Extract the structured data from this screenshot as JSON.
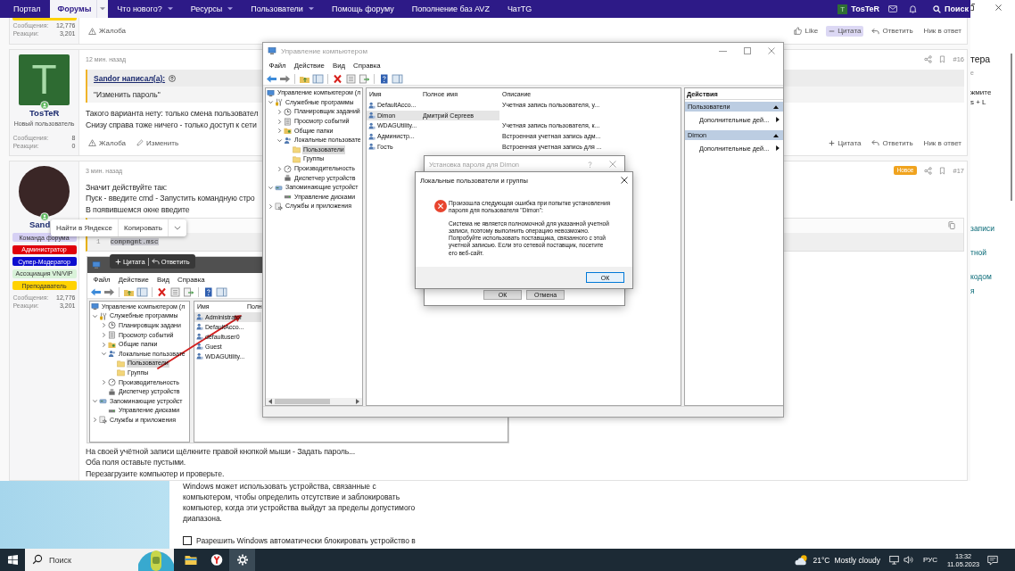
{
  "forum": {
    "nav": {
      "items": [
        {
          "label": "Портал",
          "selected": false,
          "dropdown": false
        },
        {
          "label": "Форумы",
          "selected": true,
          "dropdown": true
        },
        {
          "label": "Что нового?",
          "selected": false,
          "dropdown": true
        },
        {
          "label": "Ресурсы",
          "selected": false,
          "dropdown": true
        },
        {
          "label": "Пользователи",
          "selected": false,
          "dropdown": true
        },
        {
          "label": "Помощь форуму",
          "selected": false,
          "dropdown": false
        },
        {
          "label": "Пополнение баз AVZ",
          "selected": false,
          "dropdown": false
        },
        {
          "label": "ЧатTG",
          "selected": false,
          "dropdown": false
        }
      ],
      "account": {
        "initial": "T",
        "name": "TosTeR"
      },
      "search": "Поиск"
    },
    "posts": [
      {
        "kind": "tail",
        "author": {
          "badges": [
            {
              "color": "#ffd200"
            }
          ]
        },
        "stats": [
          {
            "label": "Сообщения:",
            "value": "12,776"
          },
          {
            "label": "Реакции:",
            "value": "3,201"
          }
        ],
        "actions": [
          {
            "kind": "report",
            "label": "Жалоба"
          }
        ],
        "reactions": [
          {
            "kind": "like",
            "label": "Like",
            "selected": false
          },
          {
            "kind": "quote",
            "label": "Цитата",
            "selected": true
          },
          {
            "kind": "reply",
            "label": "Ответить",
            "selected": false
          },
          {
            "kind": "mention",
            "label": "Ник в ответ",
            "selected": false
          }
        ]
      },
      {
        "kind": "post",
        "time": "12 мин. назад",
        "number": "#16",
        "author": {
          "avatar": {
            "kind": "letter",
            "initial": "T"
          },
          "name": "TosTeR",
          "title": "Новый пользователь",
          "online": true
        },
        "stats": [
          {
            "label": "Сообщения:",
            "value": "8"
          },
          {
            "label": "Реакции:",
            "value": "0"
          }
        ],
        "blocks": [
          {
            "kind": "quote",
            "author": "Sandor написал(а):",
            "text": "\"Изменить пароль\""
          },
          {
            "kind": "text",
            "text": "Такого варианта нету: только смена пользовател"
          },
          {
            "kind": "text",
            "text": "Снизу справа тоже ничего - только доступ к сети"
          }
        ],
        "actions": [
          {
            "kind": "report",
            "label": "Жалоба"
          },
          {
            "kind": "edit",
            "label": "Изменить"
          }
        ],
        "reactions": [
          {
            "kind": "quote",
            "label": "Цитата",
            "selected": false
          },
          {
            "kind": "reply",
            "label": "Ответить",
            "selected": false
          },
          {
            "kind": "mention",
            "label": "Ник в ответ",
            "selected": false
          }
        ]
      },
      {
        "kind": "post",
        "time": "3 мин. назад",
        "new_badge": "Новое",
        "number": "#17",
        "author": {
          "avatar": {
            "kind": "photo"
          },
          "name": "Sand",
          "online": true,
          "badges": [
            {
              "label": "Команда форума",
              "color": "#d6d0f4"
            },
            {
              "label": "Администратор",
              "color": "#e0000b"
            },
            {
              "label": "Супер-Модератор",
              "color": "#0c0ccf"
            },
            {
              "label": "Ассоциация VN/VIP",
              "color": "#d9f2d9"
            },
            {
              "label": "Преподаватель",
              "color": "#ffd200"
            }
          ]
        },
        "stats": [
          {
            "label": "Сообщения:",
            "value": "12,776"
          },
          {
            "label": "Реакции:",
            "value": "3,201"
          }
        ],
        "blocks": [
          {
            "kind": "text",
            "text": "Значит действуйте так:"
          },
          {
            "kind": "text",
            "text": "Пуск - введите cmd - Запустить командную стро"
          },
          {
            "kind": "text",
            "text": "В появившемся окне введите"
          },
          {
            "kind": "code",
            "lines": [
              {
                "number": "1",
                "text": "compmgmt.msc",
                "selected": true
              }
            ]
          },
          {
            "kind": "screenshot",
            "window": {
              "menu": [
                "Файл",
                "Действие",
                "Вид",
                "Справка"
              ],
              "tree": [
                {
                  "label": "Управление компьютером (л",
                  "kind": "computer",
                  "selected": false,
                  "children": [
                    {
                      "label": "Служебные программы",
                      "kind": "tools",
                      "expanded": true,
                      "selected": false,
                      "children": [
                        {
                          "label": "Планировщик задани",
                          "kind": "clock",
                          "expanded": false,
                          "selected": false
                        },
                        {
                          "label": "Просмотр событий",
                          "kind": "log",
                          "expanded": false,
                          "selected": false
                        },
                        {
                          "label": "Общие папки",
                          "kind": "share",
                          "expanded": false,
                          "selected": false
                        },
                        {
                          "label": "Локальные пользовате",
                          "kind": "users",
                          "expanded": true,
                          "selected": false,
                          "children": [
                            {
                              "label": "Пользователи",
                              "kind": "folder",
                              "selected": true
                            },
                            {
                              "label": "Группы",
                              "kind": "folder",
                              "selected": false
                            }
                          ]
                        },
                        {
                          "label": "Производительность",
                          "kind": "gauge",
                          "expanded": false,
                          "selected": false
                        },
                        {
                          "label": "Диспетчер устройств",
                          "kind": "device",
                          "selected": false
                        }
                      ]
                    },
                    {
                      "label": "Запоминающие устройст",
                      "kind": "storage",
                      "expanded": true,
                      "selected": false,
                      "children": [
                        {
                          "label": "Управление дисками",
                          "kind": "disk",
                          "selected": false
                        }
                      ]
                    },
                    {
                      "label": "Службы и приложения",
                      "kind": "services",
                      "expanded": false,
                      "selected": false
                    }
                  ]
                }
              ],
              "columns": [
                "Имя",
                "Полн"
              ],
              "rows": [
                {
                  "name": "Administrator",
                  "selected": true
                },
                {
                  "name": "DefaultAcco...",
                  "selected": false
                },
                {
                  "name": "defaultuser0",
                  "selected": false
                },
                {
                  "name": "Guest",
                  "selected": false
                },
                {
                  "name": "WDAGUtility...",
                  "selected": false
                }
              ]
            }
          },
          {
            "kind": "text",
            "text": "На своей учётной записи щёлкните правой кнопкой мыши - Задать пароль..."
          },
          {
            "kind": "text",
            "text": "Оба поля оставьте пустыми."
          },
          {
            "kind": "text",
            "text": "Перезагрузите компьютер и проверьте."
          }
        ]
      }
    ],
    "selection_popup": {
      "items": [
        "Найти в Яндексе",
        "Копировать"
      ]
    },
    "hover_toolbar": {
      "items": [
        {
          "kind": "quote",
          "label": "Цитата"
        },
        {
          "kind": "reply",
          "label": "Ответить"
        }
      ]
    }
  },
  "computer_management": {
    "title": "Управление компьютером",
    "active": false,
    "menu": [
      "Файл",
      "Действие",
      "Вид",
      "Справка"
    ],
    "tree": [
      {
        "label": "Управление компьютером (л",
        "kind": "computer",
        "selected": false,
        "children": [
          {
            "label": "Служебные программы",
            "kind": "tools",
            "expanded": true,
            "selected": false,
            "children": [
              {
                "label": "Планировщик заданий",
                "kind": "clock",
                "expanded": false,
                "selected": false
              },
              {
                "label": "Просмотр событий",
                "kind": "log",
                "expanded": false,
                "selected": false
              },
              {
                "label": "Общие папки",
                "kind": "share",
                "expanded": false,
                "selected": false
              },
              {
                "label": "Локальные пользовате",
                "kind": "users",
                "expanded": true,
                "selected": false,
                "children": [
                  {
                    "label": "Пользователи",
                    "kind": "folder",
                    "selected": true
                  },
                  {
                    "label": "Группы",
                    "kind": "folder",
                    "selected": false
                  }
                ]
              },
              {
                "label": "Производительность",
                "kind": "gauge",
                "expanded": false,
                "selected": false
              },
              {
                "label": "Диспетчер устройств",
                "kind": "device",
                "selected": false
              }
            ]
          },
          {
            "label": "Запоминающие устройст",
            "kind": "storage",
            "expanded": true,
            "selected": false,
            "children": [
              {
                "label": "Управление дисками",
                "kind": "disk",
                "selected": false
              }
            ]
          },
          {
            "label": "Службы и приложения",
            "kind": "services",
            "expanded": false,
            "selected": false
          }
        ]
      }
    ],
    "columns": [
      "Имя",
      "Полное имя",
      "Описание"
    ],
    "rows": [
      {
        "name": "DefaultAcco...",
        "description": "Учетная запись пользователя, у...",
        "selected": false
      },
      {
        "name": "Dimon",
        "full_name": "Дмитрий Сергеев",
        "selected": true
      },
      {
        "name": "WDAGUtility...",
        "description": "Учетная запись пользователя, к...",
        "selected": false
      },
      {
        "name": "Администр...",
        "description": "Встроенная учетная запись адм...",
        "selected": false
      },
      {
        "name": "Гость",
        "description": "Встроенная учетная запись для ...",
        "selected": false
      }
    ],
    "actions": {
      "title": "Действия",
      "sections": [
        {
          "title": "Пользователи",
          "expanded": true,
          "items": [
            "Дополнительные дей..."
          ]
        },
        {
          "title": "Dimon",
          "expanded": true,
          "items": [
            "Дополнительные дей..."
          ]
        }
      ]
    }
  },
  "dialogs": [
    {
      "kind": "password",
      "title": "Установка пароля для Dimon",
      "active": false,
      "buttons": [
        {
          "label": "ОК",
          "default": false
        },
        {
          "label": "Отмена",
          "default": false
        }
      ]
    },
    {
      "kind": "error",
      "title": "Локальные пользователи и группы",
      "active": true,
      "message": "Произошла следующая ошибка при попытке установления пароля для пользователя \"Dimon\":",
      "details": [
        "Система не является полномочной для указанной учетной записи, поэтому выполнить операцию невозможно.",
        "Попробуйте использовать поставщика, связанного с этой учетной записью. Если это сетевой поставщик, посетите его веб-сайт."
      ],
      "buttons": [
        {
          "label": "ОК",
          "default": true
        }
      ]
    }
  ],
  "settings_window": {
    "edge_texts": [
      {
        "text": "тера",
        "kind": "heading"
      },
      {
        "text": "е",
        "kind": "note"
      },
      {
        "text": "жмите",
        "kind": "body"
      },
      {
        "text": "s + L",
        "kind": "body"
      },
      {
        "text": "записи",
        "kind": "link"
      },
      {
        "text": "тной",
        "kind": "link"
      },
      {
        "text": "кодом",
        "kind": "link"
      },
      {
        "text": "я",
        "kind": "link"
      }
    ],
    "description": "Windows может использовать устройства, связанные с компьютером, чтобы определить отсутствие и заблокировать компьютер, когда эти устройства выйдут за пределы допустимого диапазона.",
    "auto_lock": {
      "label": "Разрешить Windows автоматически блокировать устройство в",
      "checked": false
    }
  },
  "taskbar": {
    "search": {
      "placeholder": "Поиск"
    },
    "apps": [
      {
        "kind": "explorer",
        "selected": false
      },
      {
        "kind": "browser",
        "selected": false
      },
      {
        "kind": "settings",
        "selected": true
      }
    ],
    "weather": {
      "temperature": "21°C",
      "condition": "Mostly cloudy"
    },
    "language": "РУС",
    "time": "13:32",
    "date": "11.05.2023"
  }
}
